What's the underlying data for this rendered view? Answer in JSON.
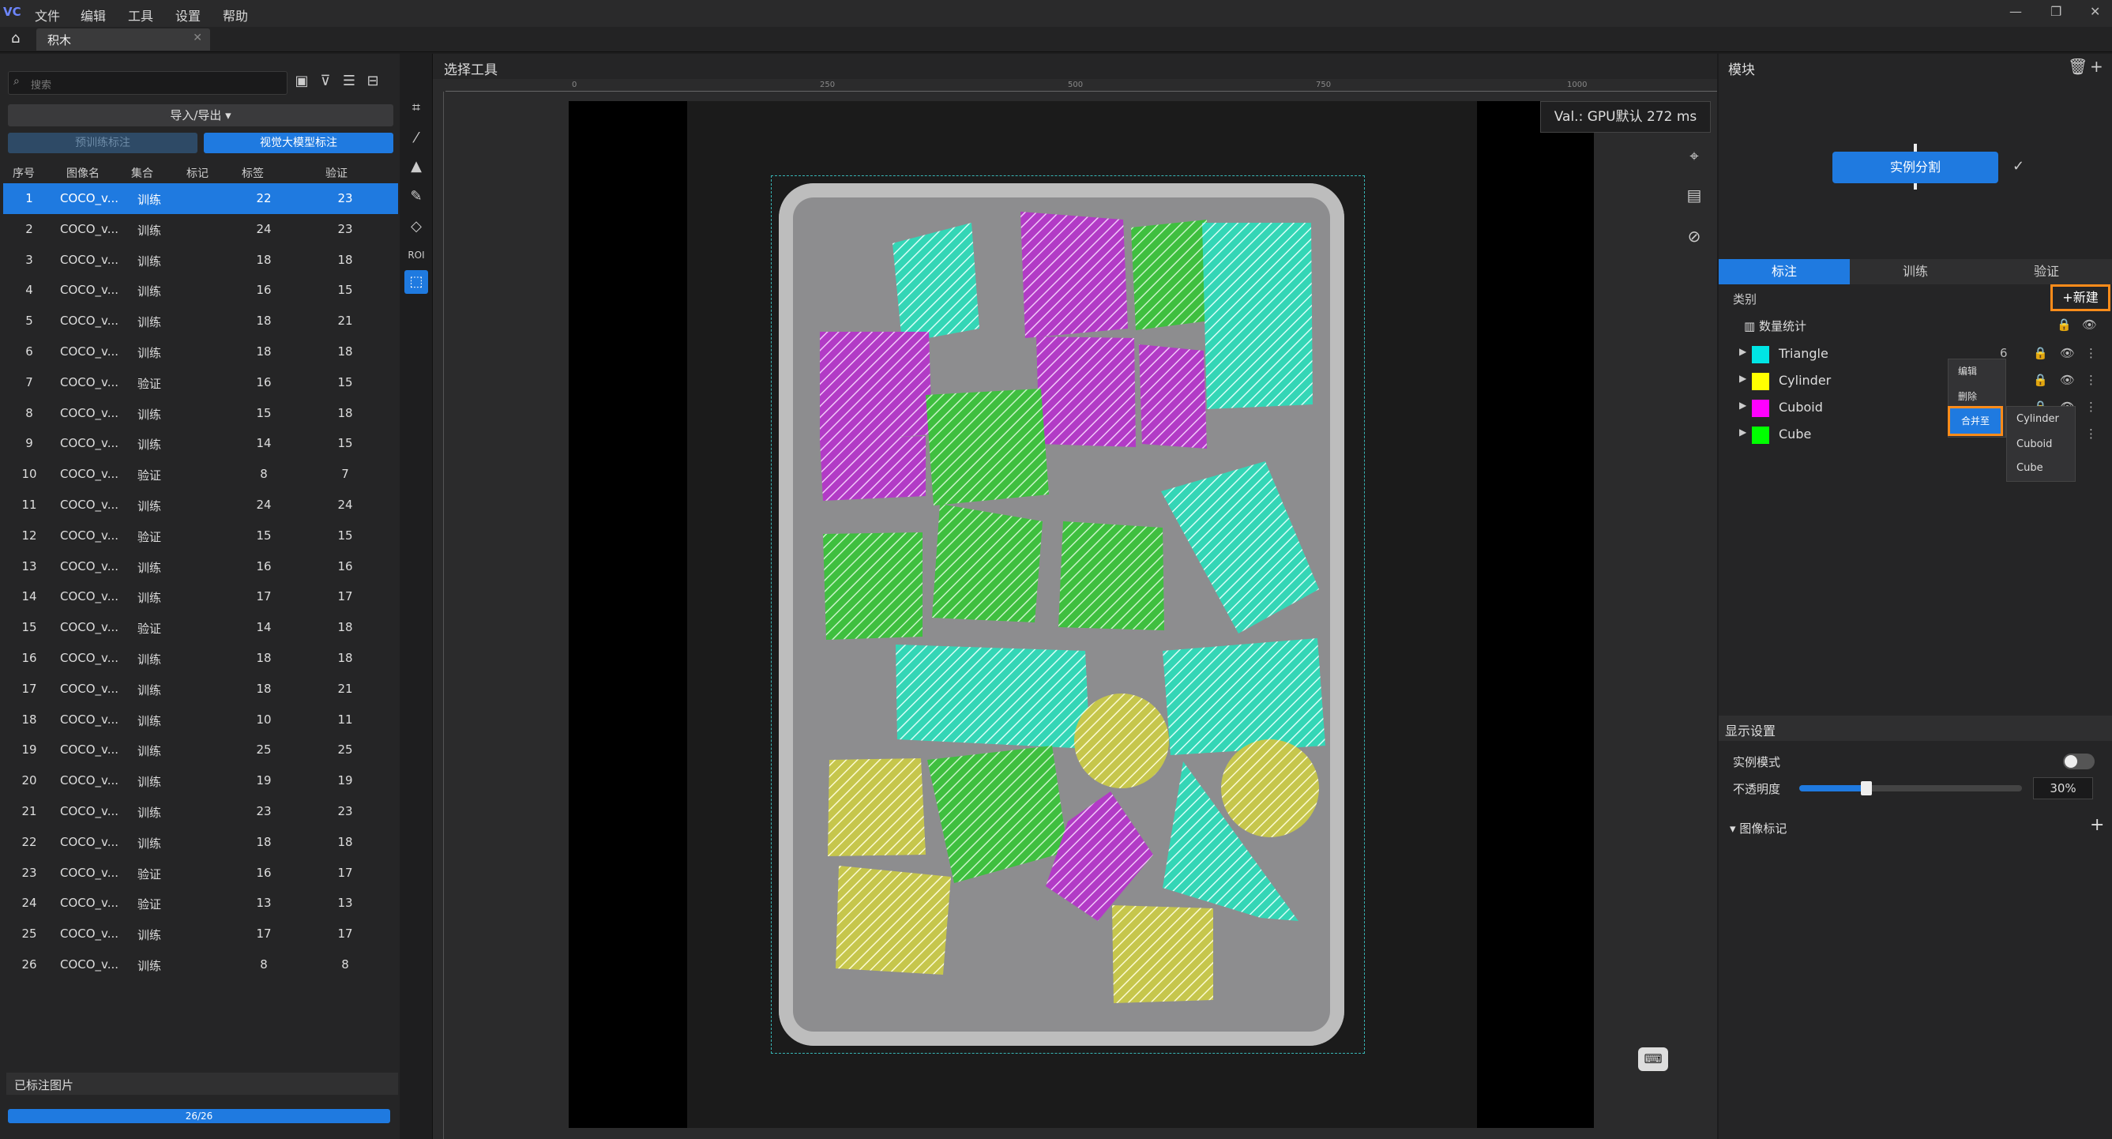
{
  "app": {
    "logo": "VC",
    "menu": [
      "文件",
      "编辑",
      "工具",
      "设置",
      "帮助"
    ]
  },
  "window_controls": [
    "—",
    "❐",
    "✕"
  ],
  "tab": {
    "title": "积木",
    "close": "✕"
  },
  "left": {
    "search_placeholder": "搜索",
    "import_export": "导入/导出 ▾",
    "pretrain_btn": "预训练标注",
    "vlm_btn": "视觉大模型标注",
    "columns": [
      "序号",
      "图像名",
      "集合",
      "标记",
      "标签",
      "验证"
    ],
    "rows": [
      [
        "1",
        "COCO_v...",
        "训练",
        "22",
        "23"
      ],
      [
        "2",
        "COCO_v...",
        "训练",
        "24",
        "23"
      ],
      [
        "3",
        "COCO_v...",
        "训练",
        "18",
        "18"
      ],
      [
        "4",
        "COCO_v...",
        "训练",
        "16",
        "15"
      ],
      [
        "5",
        "COCO_v...",
        "训练",
        "18",
        "21"
      ],
      [
        "6",
        "COCO_v...",
        "训练",
        "18",
        "18"
      ],
      [
        "7",
        "COCO_v...",
        "验证",
        "16",
        "15"
      ],
      [
        "8",
        "COCO_v...",
        "训练",
        "15",
        "18"
      ],
      [
        "9",
        "COCO_v...",
        "训练",
        "14",
        "15"
      ],
      [
        "10",
        "COCO_v...",
        "验证",
        "8",
        "7"
      ],
      [
        "11",
        "COCO_v...",
        "训练",
        "24",
        "24"
      ],
      [
        "12",
        "COCO_v...",
        "验证",
        "15",
        "15"
      ],
      [
        "13",
        "COCO_v...",
        "训练",
        "16",
        "16"
      ],
      [
        "14",
        "COCO_v...",
        "训练",
        "17",
        "17"
      ],
      [
        "15",
        "COCO_v...",
        "验证",
        "14",
        "18"
      ],
      [
        "16",
        "COCO_v...",
        "训练",
        "18",
        "18"
      ],
      [
        "17",
        "COCO_v...",
        "训练",
        "18",
        "21"
      ],
      [
        "18",
        "COCO_v...",
        "训练",
        "10",
        "11"
      ],
      [
        "19",
        "COCO_v...",
        "训练",
        "25",
        "25"
      ],
      [
        "20",
        "COCO_v...",
        "训练",
        "19",
        "19"
      ],
      [
        "21",
        "COCO_v...",
        "训练",
        "23",
        "23"
      ],
      [
        "22",
        "COCO_v...",
        "训练",
        "18",
        "18"
      ],
      [
        "23",
        "COCO_v...",
        "验证",
        "16",
        "17"
      ],
      [
        "24",
        "COCO_v...",
        "验证",
        "13",
        "13"
      ],
      [
        "25",
        "COCO_v...",
        "训练",
        "17",
        "17"
      ],
      [
        "26",
        "COCO_v...",
        "训练",
        "8",
        "8"
      ]
    ],
    "labeled_title": "已标注图片",
    "progress": "26/26"
  },
  "center": {
    "title": "选择工具",
    "ruler": [
      "0",
      "250",
      "500",
      "750",
      "1000"
    ],
    "val_tip": "Val.: GPU默认 272 ms",
    "roi_label": "ROI"
  },
  "right": {
    "module_title": "模块",
    "instance_seg": "实例分割",
    "tabs": [
      "标注",
      "训练",
      "验证"
    ],
    "category_label": "类别",
    "new_btn": "+新建",
    "stats": "数量统计",
    "categories": [
      {
        "name": "Triangle",
        "color": "#00e5e5",
        "count": "6"
      },
      {
        "name": "Cylinder",
        "color": "#ffff00",
        "count": ""
      },
      {
        "name": "Cuboid",
        "color": "#ff00ff",
        "count": ""
      },
      {
        "name": "Cube",
        "color": "#00ff00",
        "count": ""
      }
    ],
    "context_menu": [
      "编辑",
      "删除"
    ],
    "merge_to": "合并至",
    "merge_targets": [
      "Cylinder",
      "Cuboid",
      "Cube"
    ],
    "display_title": "显示设置",
    "instance_mode": "实例模式",
    "opacity_label": "不透明度",
    "opacity_value": "30%",
    "opacity_fraction": 0.3,
    "image_mark": "图像标记"
  }
}
